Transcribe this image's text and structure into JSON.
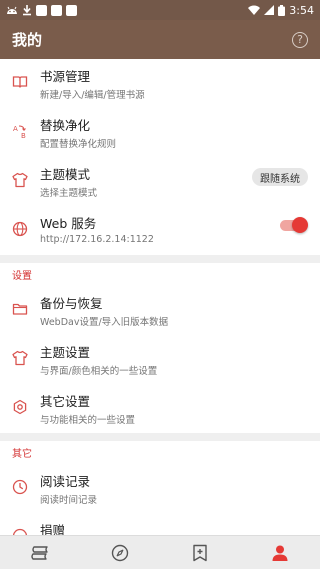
{
  "status_bar": {
    "time": "3:54"
  },
  "app_bar": {
    "title": "我的",
    "help_glyph": "?"
  },
  "items_top": [
    {
      "title": "书源管理",
      "subtitle": "新建/导入/编辑/管理书源",
      "icon": "book-icon"
    },
    {
      "title": "替换净化",
      "subtitle": "配置替换净化规则",
      "icon": "replace-icon"
    },
    {
      "title": "主题模式",
      "subtitle": "选择主题模式",
      "icon": "shirt-icon",
      "badge": "跟随系统"
    },
    {
      "title": "Web 服务",
      "subtitle": "http://172.16.2.14:1122",
      "icon": "globe-icon",
      "toggle_on": true
    }
  ],
  "section_settings": {
    "header": "设置",
    "items": [
      {
        "title": "备份与恢复",
        "subtitle": "WebDav设置/导入旧版本数据",
        "icon": "folder-icon"
      },
      {
        "title": "主题设置",
        "subtitle": "与界面/颜色相关的一些设置",
        "icon": "shirt-icon"
      },
      {
        "title": "其它设置",
        "subtitle": "与功能相关的一些设置",
        "icon": "settings-icon"
      }
    ]
  },
  "section_other": {
    "header": "其它",
    "items": [
      {
        "title": "阅读记录",
        "subtitle": "阅读时间记录",
        "icon": "clock-icon"
      },
      {
        "title": "捐赠",
        "subtitle": "",
        "icon": "donate-icon"
      }
    ]
  },
  "bottom_nav": [
    {
      "name": "bookshelf",
      "icon": "bookshelf-icon",
      "active": false
    },
    {
      "name": "explore",
      "icon": "compass-icon",
      "active": false
    },
    {
      "name": "rss",
      "icon": "bookmark-add-icon",
      "active": false
    },
    {
      "name": "mine",
      "icon": "person-icon",
      "active": true
    }
  ],
  "colors": {
    "app_bar": "#7a5c4b",
    "status_bar": "#735849",
    "accent": "#d32f2f",
    "icon": "#d9534f",
    "nav_inactive": "#555555"
  }
}
